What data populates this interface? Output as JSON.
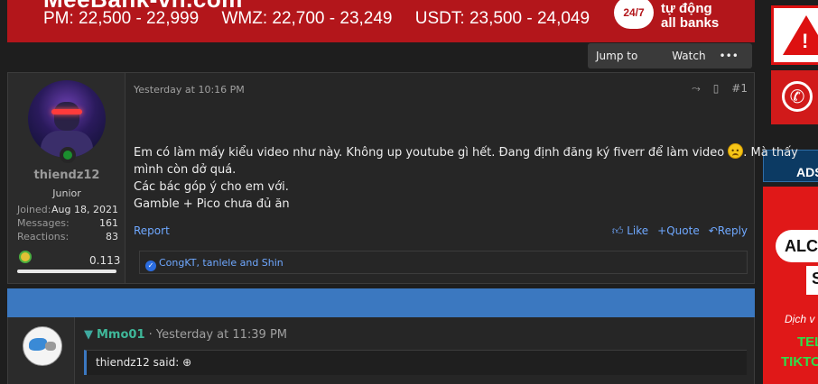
{
  "banner": {
    "title": "MeeBank-vn.com",
    "rates": [
      "PM: 22,500 - 22,999",
      "WMZ: 22,700 - 23,249",
      "USDT: 23,500 - 24,049"
    ],
    "badge": "24/7",
    "banks_line1": "tự động",
    "banks_line2": "all banks"
  },
  "toolbar": {
    "jump_label": "Jump to new",
    "watch_label": "Watch",
    "more_label": "••• ▾"
  },
  "sidebar": {
    "ads_label": "ADS",
    "ad": {
      "pill": "ALC",
      "s": "S",
      "sub": "Dịch v",
      "tel": "TEL",
      "tiktok": "TIKTOK"
    }
  },
  "post1": {
    "username": "thiendz12",
    "user_title": "Junior",
    "stats": [
      {
        "label": "Joined:",
        "value": "Aug 18, 2021"
      },
      {
        "label": "Messages:",
        "value": "161"
      },
      {
        "label": "Reactions:",
        "value": "83"
      }
    ],
    "trophy_value": "0.113",
    "date": "Yesterday at 10:16 PM",
    "number": "#1",
    "text_line1_a": "Em có làm mấy kiểu video như này. Không up youtube gì hết. Đang định đăng ký fiverr để làm video ",
    "text_line1_b": ". Mà thấy",
    "text_line2": "mình còn dở quá.",
    "text_line3": "Các bác góp ý cho em với.",
    "text_line4": "Gamble + Pico chưa đủ ăn",
    "report_label": "Report",
    "like_label": "Like",
    "quote_label": "Quote",
    "reply_label": "Reply",
    "reactions_text": "CongKT, tanlele and Shin"
  },
  "post2": {
    "username": "Mmo01",
    "date": " · Yesterday at 11:39 PM",
    "quote_author": "thiendz12 said:"
  }
}
